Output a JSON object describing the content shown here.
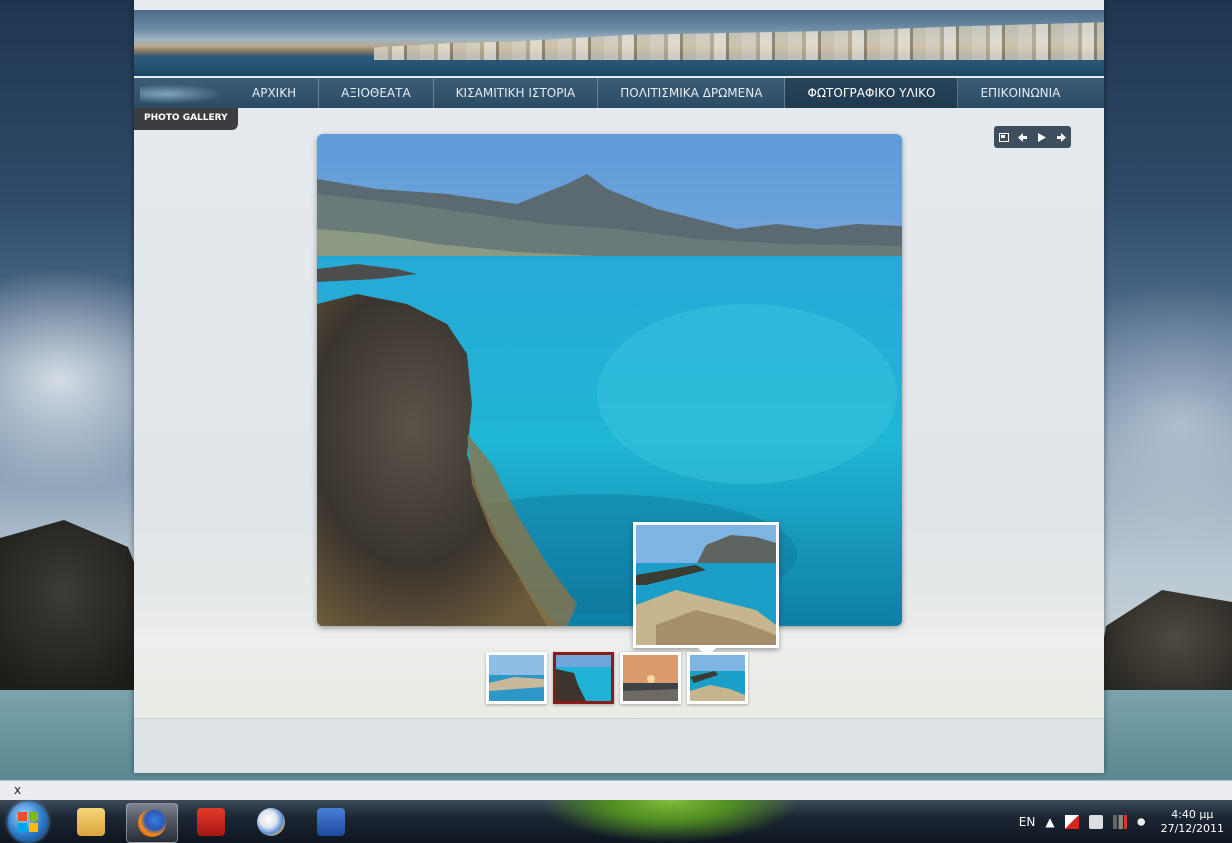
{
  "nav": {
    "items": [
      {
        "label": "ΑΡΧΙΚΗ"
      },
      {
        "label": "ΑΞΙΟΘΕΑΤΑ"
      },
      {
        "label": "ΚΙΣΑΜΙΤΙΚΗ ΙΣΤΟΡΙΑ"
      },
      {
        "label": "ΠΟΛΙΤΙΣΜΙΚΑ ΔΡΩΜΕΝΑ"
      },
      {
        "label": "ΦΩΤΟΓΡΑΦΙΚΟ ΥΛΙΚΟ"
      },
      {
        "label": "ΕΠΙΚΟΙΝΩΝΙΑ"
      }
    ],
    "active_index": 4
  },
  "gallery": {
    "tab_label": "PHOTO GALLERY",
    "controls": [
      "fullscreen-icon",
      "prev-icon",
      "play-icon",
      "next-icon"
    ],
    "thumbnails": [
      {
        "name": "beach-thumb"
      },
      {
        "name": "lagoon-rocks-thumb",
        "selected": true
      },
      {
        "name": "sunset-thumb"
      },
      {
        "name": "rocky-coast-thumb"
      }
    ]
  },
  "status": {
    "close_label": "x"
  },
  "taskbar": {
    "apps": [
      "explorer-icon",
      "firefox-icon",
      "acrobat-icon",
      "paint-icon",
      "word-icon"
    ],
    "tray": {
      "language": "EN",
      "time": "4:40 μμ",
      "date": "27/12/2011"
    }
  },
  "colors": {
    "nav_bg": "#2c4b63",
    "selected_thumb_border": "#8a1b1b",
    "photo_sea": "#1aa6c9"
  }
}
